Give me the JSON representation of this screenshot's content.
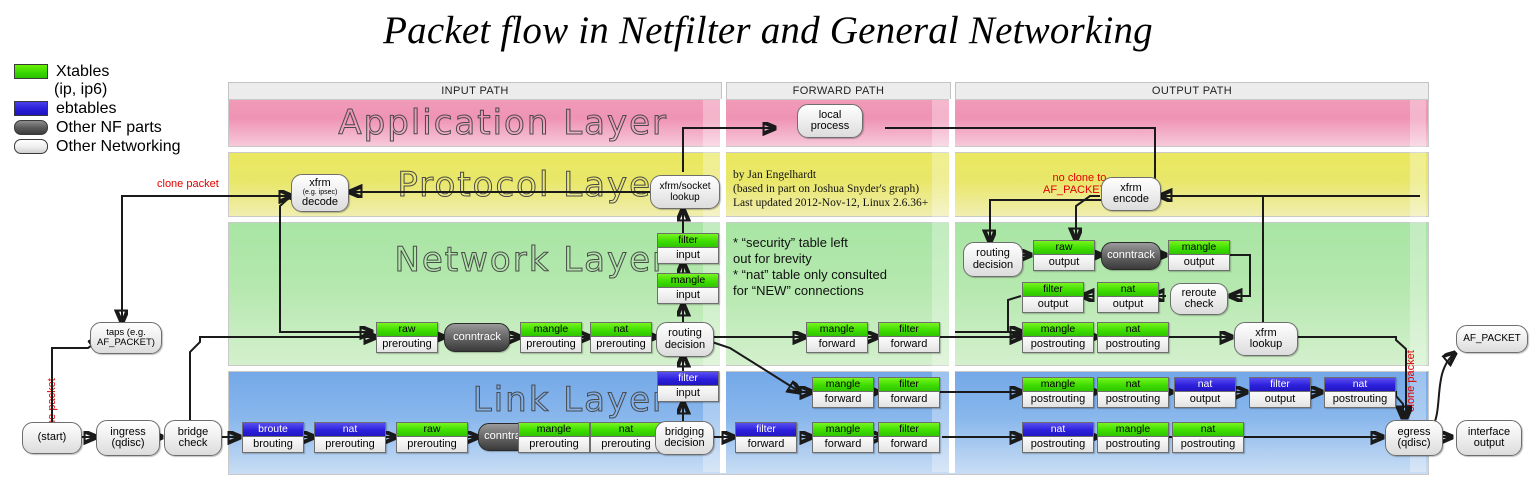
{
  "title": "Packet flow in Netfilter and General Networking",
  "legend": {
    "items": [
      {
        "name": "xtables-swatch",
        "label": "Xtables",
        "sub": "(ip, ip6)",
        "color": "#3fdd00"
      },
      {
        "name": "ebtables-swatch",
        "label": "ebtables",
        "sub": "",
        "color": "#2d20dc"
      },
      {
        "name": "other-nf-swatch",
        "label": "Other NF parts",
        "sub": "",
        "color": "#5c5c5c"
      },
      {
        "name": "other-net-swatch",
        "label": "Other Networking",
        "sub": "",
        "color": "#ededed"
      }
    ]
  },
  "paths": {
    "input": "INPUT PATH",
    "forward": "FORWARD PATH",
    "output": "OUTPUT PATH"
  },
  "layers": {
    "application": "Application Layer",
    "protocol": "Protocol Layer",
    "network": "Network Layer",
    "link": "Link Layer",
    "colors": {
      "application": "#ef93b4",
      "protocol": "#e9e76a",
      "network": "#b5e8ae",
      "link": "#89b7ec"
    }
  },
  "credits": {
    "line1": "by Jan Engelhardt",
    "line2": "(based in part on Joshua Snyder's graph)",
    "line3": "Last updated 2012-Nov-12, Linux 2.6.36+"
  },
  "notes": {
    "line1": "* “security” table left",
    "line2": "   out for brevity",
    "line3": "* “nat” table only consulted",
    "line4": "   for “NEW” connections"
  },
  "annotations": {
    "clone_left": "clone packet",
    "clone_decode": "clone packet",
    "clone_right": "clone packet",
    "no_clone_1": "no clone to",
    "no_clone_2": "AF_PACKET"
  },
  "nodes": {
    "start": {
      "label": "(start)"
    },
    "ingress": {
      "l1": "ingress",
      "l2": "(qdisc)"
    },
    "bridge_check": {
      "l1": "bridge",
      "l2": "check"
    },
    "taps": {
      "l1": "taps (e.g.",
      "l2": "AF_PACKET)"
    },
    "xfrm_decode": {
      "l1": "xfrm",
      "sm": "(e.g. ipsec)",
      "l2": "decode"
    },
    "xfrm_socket_lookup": {
      "l1": "xfrm/socket",
      "l2": "lookup"
    },
    "xfrm_encode": {
      "l1": "xfrm",
      "l2": "encode"
    },
    "xfrm_lookup": {
      "l1": "xfrm",
      "l2": "lookup"
    },
    "local_process": {
      "l1": "local",
      "l2": "process"
    },
    "routing_decision_in": {
      "l1": "routing",
      "l2": "decision"
    },
    "routing_decision_out": {
      "l1": "routing",
      "l2": "decision"
    },
    "bridging_decision": {
      "l1": "bridging",
      "l2": "decision"
    },
    "reroute_check": {
      "l1": "reroute",
      "l2": "check"
    },
    "egress": {
      "l1": "egress",
      "l2": "(qdisc)"
    },
    "interface_output": {
      "l1": "interface",
      "l2": "output"
    },
    "af_packet": {
      "label": "AF_PACKET"
    },
    "conntrack_net": {
      "label": "conntrack"
    },
    "conntrack_link": {
      "label": "conntrack"
    },
    "conntrack_out": {
      "label": "conntrack"
    }
  },
  "tables": {
    "net_in": [
      {
        "table": "raw",
        "chain": "prerouting",
        "family": "xtables"
      },
      {
        "table": "mangle",
        "chain": "prerouting",
        "family": "xtables"
      },
      {
        "table": "nat",
        "chain": "prerouting",
        "family": "xtables"
      }
    ],
    "net_input_stack": [
      {
        "table": "mangle",
        "chain": "input",
        "family": "xtables"
      },
      {
        "table": "filter",
        "chain": "input",
        "family": "xtables"
      }
    ],
    "net_forward": [
      {
        "table": "mangle",
        "chain": "forward",
        "family": "xtables"
      },
      {
        "table": "filter",
        "chain": "forward",
        "family": "xtables"
      }
    ],
    "net_output": [
      {
        "table": "raw",
        "chain": "output",
        "family": "xtables"
      },
      {
        "table": "mangle",
        "chain": "output",
        "family": "xtables"
      },
      {
        "table": "nat",
        "chain": "output",
        "family": "xtables"
      },
      {
        "table": "filter",
        "chain": "output",
        "family": "xtables"
      }
    ],
    "net_postrouting": [
      {
        "table": "mangle",
        "chain": "postrouting",
        "family": "xtables"
      },
      {
        "table": "nat",
        "chain": "postrouting",
        "family": "xtables"
      }
    ],
    "link_in": [
      {
        "table": "broute",
        "chain": "brouting",
        "family": "ebtables"
      },
      {
        "table": "nat",
        "chain": "prerouting",
        "family": "ebtables"
      },
      {
        "table": "raw",
        "chain": "prerouting",
        "family": "xtables"
      },
      {
        "table": "mangle",
        "chain": "prerouting",
        "family": "xtables"
      },
      {
        "table": "nat",
        "chain": "prerouting",
        "family": "xtables"
      }
    ],
    "link_input": [
      {
        "table": "filter",
        "chain": "input",
        "family": "ebtables"
      }
    ],
    "link_forward_mid": [
      {
        "table": "mangle",
        "chain": "forward",
        "family": "xtables"
      },
      {
        "table": "filter",
        "chain": "forward",
        "family": "xtables"
      }
    ],
    "link_forward_bottom": [
      {
        "table": "filter",
        "chain": "forward",
        "family": "ebtables"
      },
      {
        "table": "mangle",
        "chain": "forward",
        "family": "xtables"
      },
      {
        "table": "filter",
        "chain": "forward",
        "family": "xtables"
      }
    ],
    "link_post_mid": [
      {
        "table": "mangle",
        "chain": "postrouting",
        "family": "xtables"
      },
      {
        "table": "nat",
        "chain": "postrouting",
        "family": "xtables"
      },
      {
        "table": "nat",
        "chain": "output",
        "family": "ebtables"
      },
      {
        "table": "filter",
        "chain": "output",
        "family": "ebtables"
      },
      {
        "table": "nat",
        "chain": "postrouting",
        "family": "ebtables"
      }
    ],
    "link_post_bottom": [
      {
        "table": "nat",
        "chain": "postrouting",
        "family": "ebtables"
      },
      {
        "table": "mangle",
        "chain": "postrouting",
        "family": "xtables"
      },
      {
        "table": "nat",
        "chain": "postrouting",
        "family": "xtables"
      }
    ]
  }
}
